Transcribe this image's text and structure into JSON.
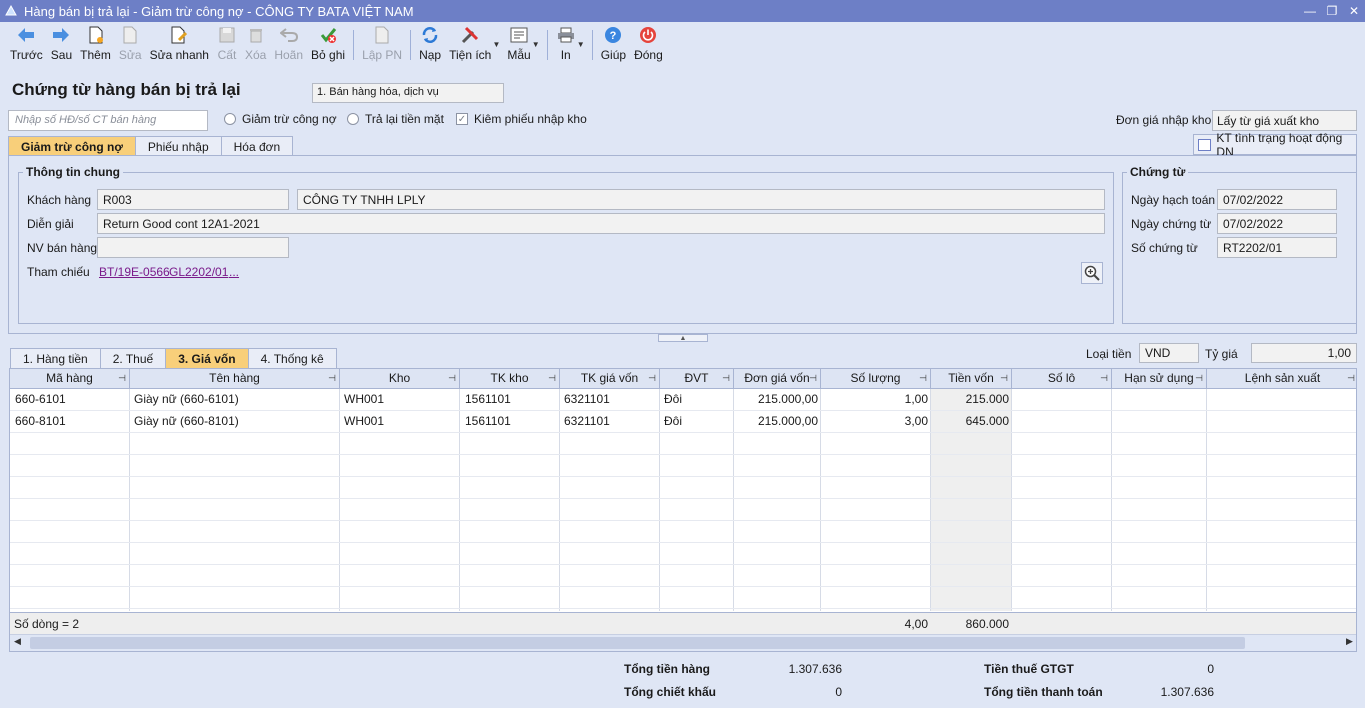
{
  "window": {
    "title": "Hàng bán bị trả lại - Giảm trừ công nợ - CÔNG TY BATA VIỆT NAM"
  },
  "toolbar": [
    {
      "label": "Trước",
      "icon": "arrow-left-icon",
      "disabled": false
    },
    {
      "label": "Sau",
      "icon": "arrow-right-icon",
      "disabled": false
    },
    {
      "label": "Thêm",
      "icon": "new-document-icon",
      "disabled": false
    },
    {
      "label": "Sửa",
      "icon": "edit-document-icon",
      "disabled": true
    },
    {
      "label": "Sửa nhanh",
      "icon": "quick-edit-icon",
      "disabled": false
    },
    {
      "label": "Cất",
      "icon": "save-icon",
      "disabled": true
    },
    {
      "label": "Xóa",
      "icon": "delete-icon",
      "disabled": true
    },
    {
      "label": "Hoãn",
      "icon": "undo-icon",
      "disabled": true
    },
    {
      "label": "Bỏ ghi",
      "icon": "unpost-icon",
      "disabled": false
    },
    {
      "label": "Lập PN",
      "icon": "create-receipt-icon",
      "disabled": true
    },
    {
      "label": "Nạp",
      "icon": "refresh-icon",
      "disabled": false
    },
    {
      "label": "Tiện ích",
      "icon": "tools-icon",
      "disabled": false
    },
    {
      "label": "Mẫu",
      "icon": "template-icon",
      "disabled": false
    },
    {
      "label": "In",
      "icon": "printer-icon",
      "disabled": false
    },
    {
      "label": "Giúp",
      "icon": "help-icon",
      "disabled": false
    },
    {
      "label": "Đóng",
      "icon": "power-icon",
      "disabled": false
    }
  ],
  "header": {
    "title": "Chứng từ hàng bán bị trả lại",
    "type": "1. Bán hàng hóa, dịch vụ",
    "search_placeholder": "Nhập số HĐ/số CT bán hàng",
    "opt_giam_tru": "Giảm trừ công nợ",
    "opt_tra_lai": "Trả lại tiền mặt",
    "chk_kiem_phieu": "Kiêm phiếu nhập kho",
    "don_gia_label": "Đơn giá nhập kho",
    "don_gia_value": "Lấy từ giá xuất kho"
  },
  "tabs_top": [
    "Giảm trừ công nợ",
    "Phiếu nhập",
    "Hóa đơn"
  ],
  "kt_button": "KT tình trạng hoạt động DN",
  "general": {
    "legend": "Thông tin chung",
    "khach_hang_label": "Khách hàng",
    "khach_hang_code": "R003",
    "khach_hang_name": "CÔNG TY TNHH LPLY",
    "dien_giai_label": "Diễn giải",
    "dien_giai": "Return Good cont 12A1-2021",
    "nv_label": "NV bán hàng",
    "nv_value": "",
    "tham_chieu_label": "Tham chiếu",
    "ref1": "BT/19E-0566",
    "ref2": "GL2202/01",
    "ref_more": "..."
  },
  "voucher": {
    "legend": "Chứng từ",
    "ngay_ht_label": "Ngày hạch toán",
    "ngay_ht": "07/02/2022",
    "ngay_ct_label": "Ngày chứng từ",
    "ngay_ct": "07/02/2022",
    "so_ct_label": "Số chứng từ",
    "so_ct": "RT2202/01"
  },
  "tabs_bottom": [
    "1. Hàng tiền",
    "2. Thuế",
    "3. Giá vốn",
    "4. Thống kê"
  ],
  "currency": {
    "label": "Loại tiền",
    "value": "VND",
    "rate_label": "Tỷ giá",
    "rate": "1,00"
  },
  "grid": {
    "columns": [
      "Mã hàng",
      "Tên hàng",
      "Kho",
      "TK kho",
      "TK giá vốn",
      "ĐVT",
      "Đơn giá vốn",
      "Số lượng",
      "Tiền vốn",
      "Số lô",
      "Hạn sử dụng",
      "Lệnh sản xuất"
    ],
    "rows": [
      [
        "660-6101",
        "Giày nữ (660-6101)",
        "WH001",
        "1561101",
        "6321101",
        "Đôi",
        "215.000,00",
        "1,00",
        "215.000",
        "",
        "",
        ""
      ],
      [
        "660-8101",
        "Giày nữ (660-8101)",
        "WH001",
        "1561101",
        "6321101",
        "Đôi",
        "215.000,00",
        "3,00",
        "645.000",
        "",
        "",
        ""
      ]
    ],
    "footer_count": "Số dòng = 2",
    "footer_qty": "4,00",
    "footer_amount": "860.000"
  },
  "totals": {
    "tong_tien_hang_label": "Tổng tiền hàng",
    "tong_tien_hang": "1.307.636",
    "tong_ck_label": "Tổng chiết khấu",
    "tong_ck": "0",
    "thue_label": "Tiền thuế GTGT",
    "thue": "0",
    "tong_tt_label": "Tổng tiền thanh toán",
    "tong_tt": "1.307.636"
  }
}
